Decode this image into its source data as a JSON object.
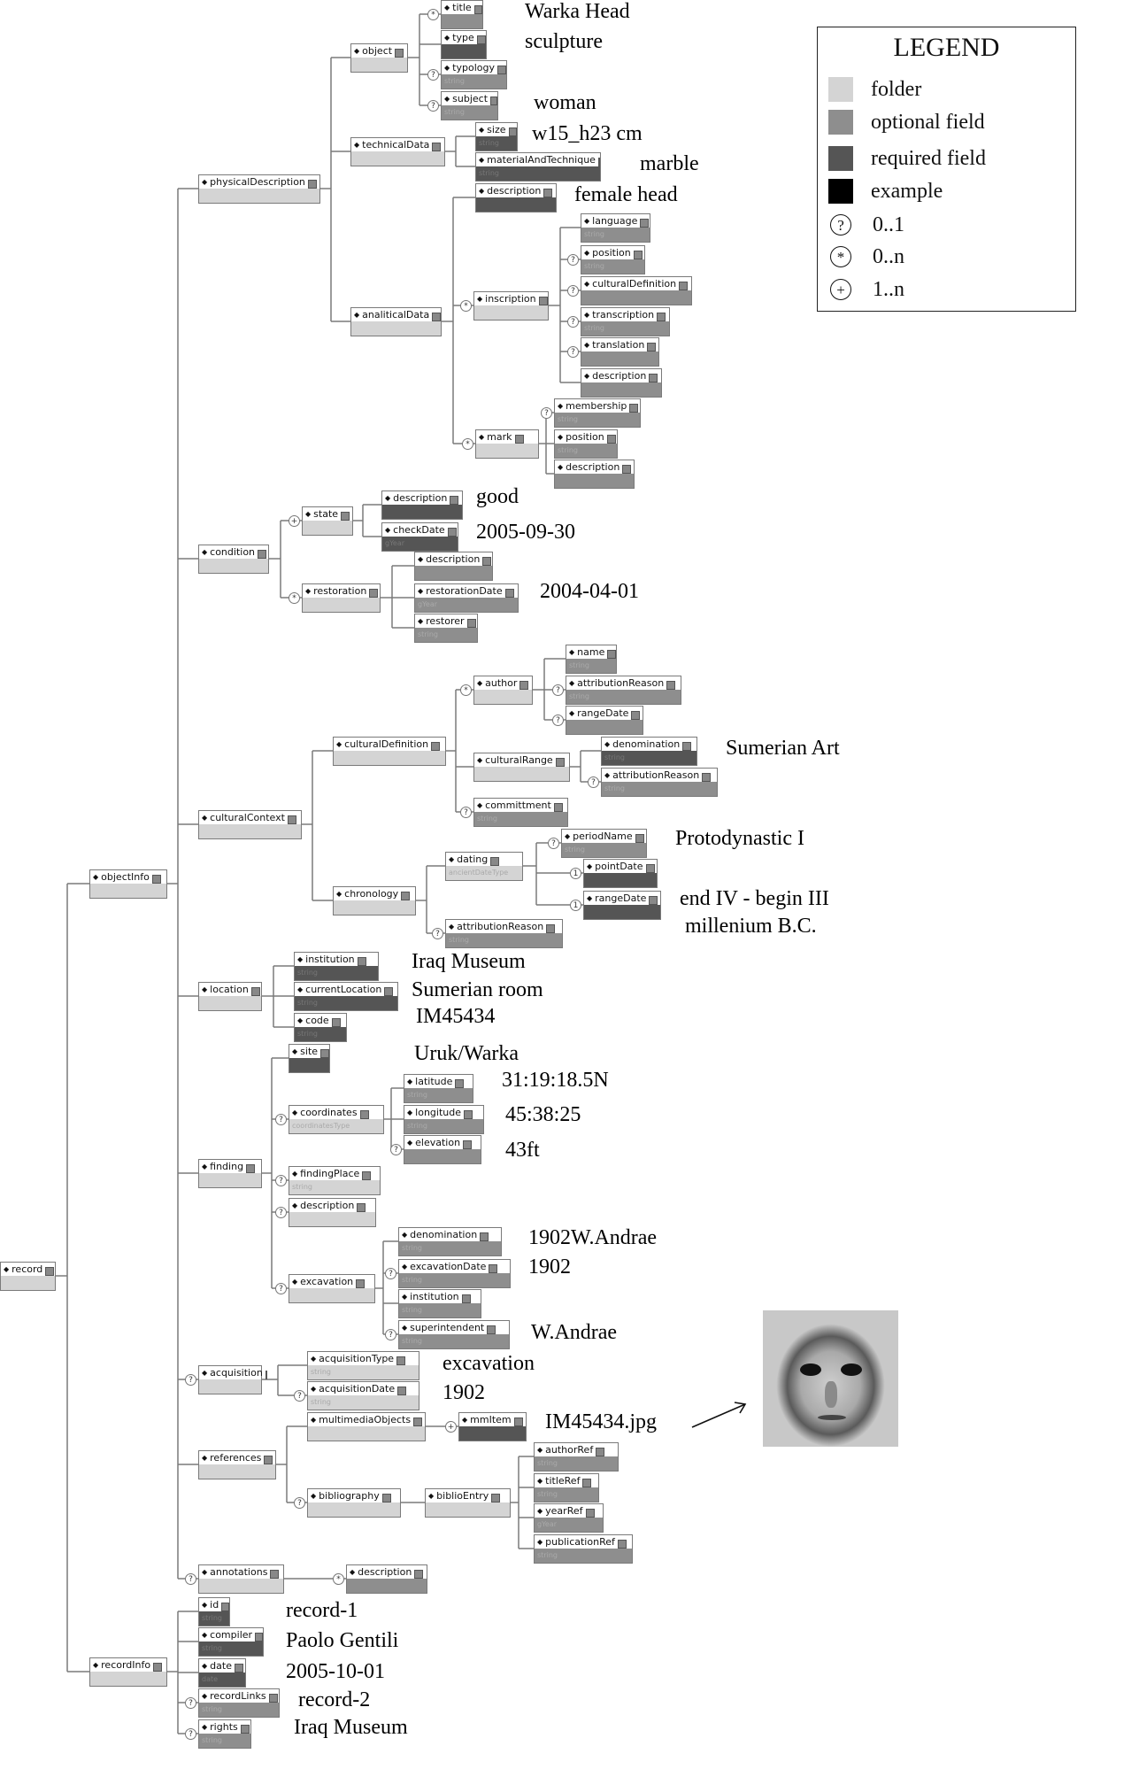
{
  "legend": {
    "title": "LEGEND",
    "items": [
      {
        "swatch": "#d4d4d4",
        "label": "folder"
      },
      {
        "swatch": "#8e8e8e",
        "label": "optional  field"
      },
      {
        "swatch": "#555555",
        "label": "required  field"
      },
      {
        "swatch": "#000000",
        "label": "example"
      }
    ],
    "cardinalities": [
      {
        "symbol": "?",
        "label": "0..1"
      },
      {
        "symbol": "*",
        "label": "0..n"
      },
      {
        "symbol": "+",
        "label": "1..n"
      }
    ]
  },
  "nodes": [
    {
      "id": "record",
      "label": "record",
      "kind": "folder"
    },
    {
      "id": "objectInfo",
      "label": "objectInfo",
      "kind": "folder",
      "parent": "record"
    },
    {
      "id": "physicalDescription",
      "label": "physicalDescription",
      "kind": "folder",
      "parent": "objectInfo"
    },
    {
      "id": "object",
      "label": "object",
      "kind": "folder",
      "parent": "physicalDescription"
    },
    {
      "id": "title",
      "label": "title",
      "kind": "optional",
      "parent": "object",
      "card": "*"
    },
    {
      "id": "type",
      "label": "type",
      "kind": "required",
      "parent": "object"
    },
    {
      "id": "typology",
      "label": "typology",
      "kind": "optional",
      "type": "string",
      "parent": "object",
      "card": "?"
    },
    {
      "id": "subject",
      "label": "subject",
      "kind": "optional",
      "type": "string",
      "parent": "object",
      "card": "?"
    },
    {
      "id": "technicalData",
      "label": "technicalData",
      "kind": "folder",
      "parent": "physicalDescription"
    },
    {
      "id": "size",
      "label": "size",
      "kind": "required",
      "type": "string",
      "parent": "technicalData"
    },
    {
      "id": "materialAndTechnique",
      "label": "materialAndTechnique",
      "kind": "required",
      "type": "string",
      "parent": "technicalData"
    },
    {
      "id": "analiticalData",
      "label": "analiticalData",
      "kind": "folder",
      "parent": "physicalDescription"
    },
    {
      "id": "ad_description",
      "label": "description",
      "kind": "required",
      "parent": "analiticalData"
    },
    {
      "id": "inscription",
      "label": "inscription",
      "kind": "folder",
      "parent": "analiticalData",
      "card": "*"
    },
    {
      "id": "language",
      "label": "language",
      "kind": "optional",
      "type": "string",
      "parent": "inscription"
    },
    {
      "id": "ins_position",
      "label": "position",
      "kind": "optional",
      "type": "string",
      "parent": "inscription",
      "card": "?"
    },
    {
      "id": "ins_culturalDefinition",
      "label": "culturalDefinition",
      "kind": "optional",
      "parent": "inscription",
      "card": "?"
    },
    {
      "id": "transcription",
      "label": "transcription",
      "kind": "optional",
      "type": "string",
      "parent": "inscription",
      "card": "?"
    },
    {
      "id": "translation",
      "label": "translation",
      "kind": "optional",
      "parent": "inscription",
      "card": "?"
    },
    {
      "id": "ins_description",
      "label": "description",
      "kind": "optional",
      "parent": "inscription"
    },
    {
      "id": "mark",
      "label": "mark",
      "kind": "folder",
      "parent": "analiticalData",
      "card": "*"
    },
    {
      "id": "membership",
      "label": "membership",
      "kind": "optional",
      "type": "string",
      "parent": "mark",
      "card": "?"
    },
    {
      "id": "mark_position",
      "label": "position",
      "kind": "optional",
      "type": "string",
      "parent": "mark"
    },
    {
      "id": "mark_description",
      "label": "description",
      "kind": "optional",
      "parent": "mark"
    },
    {
      "id": "condition",
      "label": "condition",
      "kind": "folder",
      "parent": "objectInfo"
    },
    {
      "id": "state",
      "label": "state",
      "kind": "folder",
      "parent": "condition",
      "card": "+"
    },
    {
      "id": "state_description",
      "label": "description",
      "kind": "required",
      "parent": "state"
    },
    {
      "id": "checkDate",
      "label": "checkDate",
      "kind": "required",
      "type": "gYear",
      "parent": "state"
    },
    {
      "id": "restoration",
      "label": "restoration",
      "kind": "folder",
      "parent": "condition",
      "card": "*"
    },
    {
      "id": "rest_description",
      "label": "description",
      "kind": "optional",
      "parent": "restoration"
    },
    {
      "id": "restorationDate",
      "label": "restorationDate",
      "kind": "optional",
      "type": "gYear",
      "parent": "restoration"
    },
    {
      "id": "restorer",
      "label": "restorer",
      "kind": "optional",
      "type": "string",
      "parent": "restoration"
    },
    {
      "id": "culturalContext",
      "label": "culturalContext",
      "kind": "folder",
      "parent": "objectInfo"
    },
    {
      "id": "culturalDefinition",
      "label": "culturalDefinition",
      "kind": "folder",
      "parent": "culturalContext"
    },
    {
      "id": "author",
      "label": "author",
      "kind": "folder",
      "parent": "culturalDefinition",
      "card": "*"
    },
    {
      "id": "name",
      "label": "name",
      "kind": "optional",
      "type": "string",
      "parent": "author"
    },
    {
      "id": "author_attributionReason",
      "label": "attributionReason",
      "kind": "optional",
      "type": "string",
      "parent": "author",
      "card": "?"
    },
    {
      "id": "author_rangeDate",
      "label": "rangeDate",
      "kind": "optional",
      "parent": "author",
      "card": "?"
    },
    {
      "id": "culturalRange",
      "label": "culturalRange",
      "kind": "folder",
      "parent": "culturalDefinition"
    },
    {
      "id": "cr_denomination",
      "label": "denomination",
      "kind": "required",
      "type": "string",
      "parent": "culturalRange"
    },
    {
      "id": "cr_attributionReason",
      "label": "attributionReason",
      "kind": "optional",
      "type": "string",
      "parent": "culturalRange",
      "card": "?"
    },
    {
      "id": "committment",
      "label": "committment",
      "kind": "optional",
      "type": "string",
      "parent": "culturalDefinition",
      "card": "?"
    },
    {
      "id": "chronology",
      "label": "chronology",
      "kind": "folder",
      "parent": "culturalContext"
    },
    {
      "id": "dating",
      "label": "dating",
      "kind": "folder",
      "type": "ancientDateType",
      "parent": "chronology"
    },
    {
      "id": "periodName",
      "label": "periodName",
      "kind": "optional",
      "type": "string",
      "parent": "dating",
      "card": "?"
    },
    {
      "id": "pointDate",
      "label": "pointDate",
      "kind": "required",
      "parent": "dating",
      "card": "1"
    },
    {
      "id": "dating_rangeDate",
      "label": "rangeDate",
      "kind": "required",
      "parent": "dating",
      "card": "1"
    },
    {
      "id": "chron_attributionReason",
      "label": "attributionReason",
      "kind": "optional",
      "type": "string",
      "parent": "chronology",
      "card": "?"
    },
    {
      "id": "location",
      "label": "location",
      "kind": "folder",
      "parent": "objectInfo"
    },
    {
      "id": "institution",
      "label": "institution",
      "kind": "required",
      "type": "string",
      "parent": "location"
    },
    {
      "id": "currentLocation",
      "label": "currentLocation",
      "kind": "required",
      "type": "string",
      "parent": "location"
    },
    {
      "id": "code",
      "label": "code",
      "kind": "required",
      "type": "string",
      "parent": "location"
    },
    {
      "id": "finding",
      "label": "finding",
      "kind": "folder",
      "parent": "objectInfo"
    },
    {
      "id": "site",
      "label": "site",
      "kind": "required",
      "parent": "finding"
    },
    {
      "id": "coordinates",
      "label": "coordinates",
      "kind": "folder",
      "type": "coordinatesType",
      "parent": "finding",
      "card": "?"
    },
    {
      "id": "latitude",
      "label": "latitude",
      "kind": "optional",
      "type": "string",
      "parent": "coordinates"
    },
    {
      "id": "longitude",
      "label": "longitude",
      "kind": "optional",
      "type": "string",
      "parent": "coordinates"
    },
    {
      "id": "elevation",
      "label": "elevation",
      "kind": "optional",
      "parent": "coordinates",
      "card": "?"
    },
    {
      "id": "findingPlace",
      "label": "findingPlace",
      "kind": "folder",
      "type": "string",
      "parent": "finding",
      "card": "?"
    },
    {
      "id": "finding_description",
      "label": "description",
      "kind": "folder",
      "parent": "finding",
      "card": "?"
    },
    {
      "id": "excavation",
      "label": "excavation",
      "kind": "folder",
      "parent": "finding",
      "card": "?"
    },
    {
      "id": "exc_denomination",
      "label": "denomination",
      "kind": "optional",
      "type": "string",
      "parent": "excavation"
    },
    {
      "id": "excavationDate",
      "label": "excavationDate",
      "kind": "optional",
      "type": "string",
      "parent": "excavation",
      "card": "?"
    },
    {
      "id": "exc_institution",
      "label": "institution",
      "kind": "optional",
      "type": "string",
      "parent": "excavation"
    },
    {
      "id": "superintendent",
      "label": "superintendent",
      "kind": "optional",
      "type": "string",
      "parent": "excavation",
      "card": "?"
    },
    {
      "id": "acquisition",
      "label": "acquisition",
      "kind": "folder",
      "parent": "objectInfo",
      "card": "?"
    },
    {
      "id": "acquisitionType",
      "label": "acquisitionType",
      "kind": "folder",
      "type": "string",
      "parent": "acquisition"
    },
    {
      "id": "acquisitionDate",
      "label": "acquisitionDate",
      "kind": "folder",
      "type": "string",
      "parent": "acquisition",
      "card": "?"
    },
    {
      "id": "references",
      "label": "references",
      "kind": "folder",
      "parent": "objectInfo"
    },
    {
      "id": "multimediaObjects",
      "label": "multimediaObjects",
      "kind": "folder",
      "parent": "references"
    },
    {
      "id": "mmItem",
      "label": "mmItem",
      "kind": "required",
      "parent": "multimediaObjects",
      "card": "+"
    },
    {
      "id": "bibliography",
      "label": "bibliography",
      "kind": "folder",
      "parent": "references",
      "card": "?"
    },
    {
      "id": "biblioEntry",
      "label": "biblioEntry",
      "kind": "folder",
      "parent": "bibliography"
    },
    {
      "id": "authorRef",
      "label": "authorRef",
      "kind": "optional",
      "type": "string",
      "parent": "biblioEntry"
    },
    {
      "id": "titleRef",
      "label": "titleRef",
      "kind": "optional",
      "type": "string",
      "parent": "biblioEntry"
    },
    {
      "id": "yearRef",
      "label": "yearRef",
      "kind": "optional",
      "type": "gYear",
      "parent": "biblioEntry"
    },
    {
      "id": "publicationRef",
      "label": "publicationRef",
      "kind": "optional",
      "type": "string",
      "parent": "biblioEntry"
    },
    {
      "id": "annotations",
      "label": "annotations",
      "kind": "folder",
      "parent": "objectInfo",
      "card": "?"
    },
    {
      "id": "ann_description",
      "label": "description",
      "kind": "optional",
      "parent": "annotations",
      "card": "*"
    },
    {
      "id": "recordInfo",
      "label": "recordInfo",
      "kind": "folder",
      "parent": "record"
    },
    {
      "id": "rid",
      "label": "id",
      "kind": "required",
      "type": "string",
      "parent": "recordInfo"
    },
    {
      "id": "compiler",
      "label": "compiler",
      "kind": "required",
      "type": "string",
      "parent": "recordInfo"
    },
    {
      "id": "date",
      "label": "date",
      "kind": "required",
      "type": "date",
      "parent": "recordInfo"
    },
    {
      "id": "recordLinks",
      "label": "recordLinks",
      "kind": "optional",
      "type": "string",
      "parent": "recordInfo",
      "card": "?"
    },
    {
      "id": "rights",
      "label": "rights",
      "kind": "optional",
      "type": "string",
      "parent": "recordInfo",
      "card": "?"
    }
  ],
  "examples": [
    {
      "id": "ex_title",
      "text": "Warka Head"
    },
    {
      "id": "ex_type",
      "text": "sculpture"
    },
    {
      "id": "ex_subject",
      "text": "woman"
    },
    {
      "id": "ex_size",
      "text": "w15_h23 cm"
    },
    {
      "id": "ex_material",
      "text": "marble"
    },
    {
      "id": "ex_description",
      "text": "female head"
    },
    {
      "id": "ex_state",
      "text": "good"
    },
    {
      "id": "ex_checkDate",
      "text": "2005-09-30"
    },
    {
      "id": "ex_restorationDate",
      "text": "2004-04-01"
    },
    {
      "id": "ex_culturalRange",
      "text": "Sumerian Art"
    },
    {
      "id": "ex_periodName",
      "text": "Protodynastic I"
    },
    {
      "id": "ex_rangeDate1",
      "text": "end IV - begin III"
    },
    {
      "id": "ex_rangeDate2",
      "text": "millenium B.C."
    },
    {
      "id": "ex_institution",
      "text": "Iraq Museum"
    },
    {
      "id": "ex_currentLocation",
      "text": "Sumerian  room"
    },
    {
      "id": "ex_code",
      "text": "IM45434"
    },
    {
      "id": "ex_site",
      "text": "Uruk/Warka"
    },
    {
      "id": "ex_latitude",
      "text": "31:19:18.5N"
    },
    {
      "id": "ex_longitude",
      "text": "45:38:25"
    },
    {
      "id": "ex_elevation",
      "text": "43ft"
    },
    {
      "id": "ex_excDenomination",
      "text": "1902W.Andrae"
    },
    {
      "id": "ex_excDate",
      "text": "1902"
    },
    {
      "id": "ex_superintendent",
      "text": "W.Andrae"
    },
    {
      "id": "ex_acqType",
      "text": "excavation"
    },
    {
      "id": "ex_acqDate",
      "text": "1902"
    },
    {
      "id": "ex_mmItem",
      "text": "IM45434.jpg"
    },
    {
      "id": "ex_id",
      "text": "record-1"
    },
    {
      "id": "ex_compiler",
      "text": "Paolo Gentili"
    },
    {
      "id": "ex_date",
      "text": "2005-10-01"
    },
    {
      "id": "ex_recordLinks",
      "text": "record-2"
    },
    {
      "id": "ex_rights",
      "text": "Iraq Museum"
    }
  ],
  "photo": {
    "caption": "Warka Head photograph"
  }
}
